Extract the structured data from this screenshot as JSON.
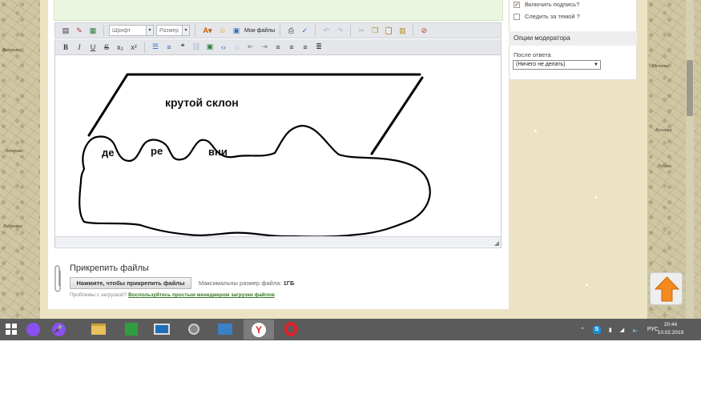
{
  "editor_toolbar": {
    "font_select": "Шрифт",
    "size_select": "Размер",
    "my_files_label": "Мои файлы"
  },
  "editor": {
    "drawing_labels": {
      "slope": "крутой склон",
      "village_part1": "де",
      "village_part2": "ре",
      "village_part3": "вни"
    }
  },
  "sidebar": {
    "signature_label": "Включить подпись?",
    "signature_checked": true,
    "follow_label": "Следить за темой ?",
    "follow_checked": false,
    "moderator_title": "Опции модератора",
    "after_reply_label": "После ответа",
    "after_reply_value": "(Ничего не делать)"
  },
  "attachments": {
    "title": "Прикрепить файлы",
    "button_label": "Нажмите, чтобы прикрепить файлы",
    "max_size_label": "Максимальны размер файла:",
    "max_size_value": "1ГБ",
    "help_prefix": "Проблемы с загрузкой?",
    "help_link": "Воспользуйтесь простым менеджером загрузки файлов"
  },
  "map_labels": [
    "Ветрино",
    "Петрово",
    "Бобровка",
    "Мечеть",
    "Кегинки",
    "Лугино"
  ],
  "taskbar": {
    "language": "РУС",
    "time": "20:44",
    "date": "10.02.2019"
  },
  "colors": {
    "accent_orange": "#f28a1e",
    "link_green": "#3d7a2a",
    "taskbar_bg": "#5b5b5b"
  }
}
